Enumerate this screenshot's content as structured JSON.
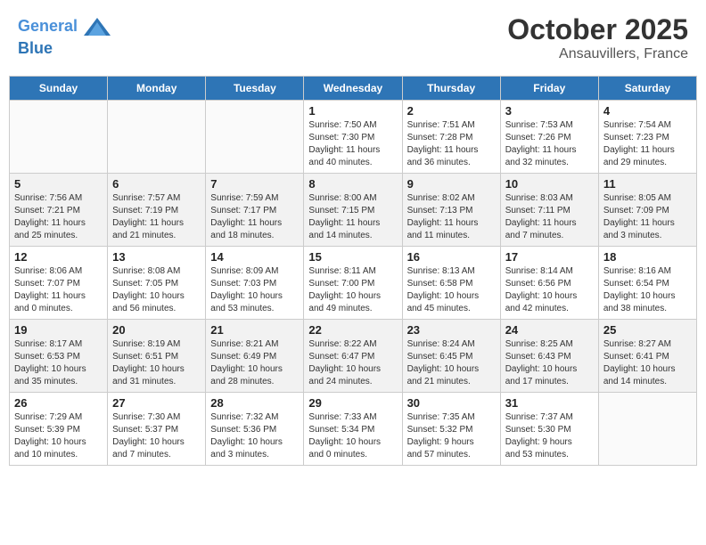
{
  "header": {
    "logo_line1": "General",
    "logo_line2": "Blue",
    "month": "October 2025",
    "location": "Ansauvillers, France"
  },
  "days_of_week": [
    "Sunday",
    "Monday",
    "Tuesday",
    "Wednesday",
    "Thursday",
    "Friday",
    "Saturday"
  ],
  "weeks": [
    [
      {
        "day": "",
        "info": ""
      },
      {
        "day": "",
        "info": ""
      },
      {
        "day": "",
        "info": ""
      },
      {
        "day": "1",
        "info": "Sunrise: 7:50 AM\nSunset: 7:30 PM\nDaylight: 11 hours\nand 40 minutes."
      },
      {
        "day": "2",
        "info": "Sunrise: 7:51 AM\nSunset: 7:28 PM\nDaylight: 11 hours\nand 36 minutes."
      },
      {
        "day": "3",
        "info": "Sunrise: 7:53 AM\nSunset: 7:26 PM\nDaylight: 11 hours\nand 32 minutes."
      },
      {
        "day": "4",
        "info": "Sunrise: 7:54 AM\nSunset: 7:23 PM\nDaylight: 11 hours\nand 29 minutes."
      }
    ],
    [
      {
        "day": "5",
        "info": "Sunrise: 7:56 AM\nSunset: 7:21 PM\nDaylight: 11 hours\nand 25 minutes."
      },
      {
        "day": "6",
        "info": "Sunrise: 7:57 AM\nSunset: 7:19 PM\nDaylight: 11 hours\nand 21 minutes."
      },
      {
        "day": "7",
        "info": "Sunrise: 7:59 AM\nSunset: 7:17 PM\nDaylight: 11 hours\nand 18 minutes."
      },
      {
        "day": "8",
        "info": "Sunrise: 8:00 AM\nSunset: 7:15 PM\nDaylight: 11 hours\nand 14 minutes."
      },
      {
        "day": "9",
        "info": "Sunrise: 8:02 AM\nSunset: 7:13 PM\nDaylight: 11 hours\nand 11 minutes."
      },
      {
        "day": "10",
        "info": "Sunrise: 8:03 AM\nSunset: 7:11 PM\nDaylight: 11 hours\nand 7 minutes."
      },
      {
        "day": "11",
        "info": "Sunrise: 8:05 AM\nSunset: 7:09 PM\nDaylight: 11 hours\nand 3 minutes."
      }
    ],
    [
      {
        "day": "12",
        "info": "Sunrise: 8:06 AM\nSunset: 7:07 PM\nDaylight: 11 hours\nand 0 minutes."
      },
      {
        "day": "13",
        "info": "Sunrise: 8:08 AM\nSunset: 7:05 PM\nDaylight: 10 hours\nand 56 minutes."
      },
      {
        "day": "14",
        "info": "Sunrise: 8:09 AM\nSunset: 7:03 PM\nDaylight: 10 hours\nand 53 minutes."
      },
      {
        "day": "15",
        "info": "Sunrise: 8:11 AM\nSunset: 7:00 PM\nDaylight: 10 hours\nand 49 minutes."
      },
      {
        "day": "16",
        "info": "Sunrise: 8:13 AM\nSunset: 6:58 PM\nDaylight: 10 hours\nand 45 minutes."
      },
      {
        "day": "17",
        "info": "Sunrise: 8:14 AM\nSunset: 6:56 PM\nDaylight: 10 hours\nand 42 minutes."
      },
      {
        "day": "18",
        "info": "Sunrise: 8:16 AM\nSunset: 6:54 PM\nDaylight: 10 hours\nand 38 minutes."
      }
    ],
    [
      {
        "day": "19",
        "info": "Sunrise: 8:17 AM\nSunset: 6:53 PM\nDaylight: 10 hours\nand 35 minutes."
      },
      {
        "day": "20",
        "info": "Sunrise: 8:19 AM\nSunset: 6:51 PM\nDaylight: 10 hours\nand 31 minutes."
      },
      {
        "day": "21",
        "info": "Sunrise: 8:21 AM\nSunset: 6:49 PM\nDaylight: 10 hours\nand 28 minutes."
      },
      {
        "day": "22",
        "info": "Sunrise: 8:22 AM\nSunset: 6:47 PM\nDaylight: 10 hours\nand 24 minutes."
      },
      {
        "day": "23",
        "info": "Sunrise: 8:24 AM\nSunset: 6:45 PM\nDaylight: 10 hours\nand 21 minutes."
      },
      {
        "day": "24",
        "info": "Sunrise: 8:25 AM\nSunset: 6:43 PM\nDaylight: 10 hours\nand 17 minutes."
      },
      {
        "day": "25",
        "info": "Sunrise: 8:27 AM\nSunset: 6:41 PM\nDaylight: 10 hours\nand 14 minutes."
      }
    ],
    [
      {
        "day": "26",
        "info": "Sunrise: 7:29 AM\nSunset: 5:39 PM\nDaylight: 10 hours\nand 10 minutes."
      },
      {
        "day": "27",
        "info": "Sunrise: 7:30 AM\nSunset: 5:37 PM\nDaylight: 10 hours\nand 7 minutes."
      },
      {
        "day": "28",
        "info": "Sunrise: 7:32 AM\nSunset: 5:36 PM\nDaylight: 10 hours\nand 3 minutes."
      },
      {
        "day": "29",
        "info": "Sunrise: 7:33 AM\nSunset: 5:34 PM\nDaylight: 10 hours\nand 0 minutes."
      },
      {
        "day": "30",
        "info": "Sunrise: 7:35 AM\nSunset: 5:32 PM\nDaylight: 9 hours\nand 57 minutes."
      },
      {
        "day": "31",
        "info": "Sunrise: 7:37 AM\nSunset: 5:30 PM\nDaylight: 9 hours\nand 53 minutes."
      },
      {
        "day": "",
        "info": ""
      }
    ]
  ]
}
